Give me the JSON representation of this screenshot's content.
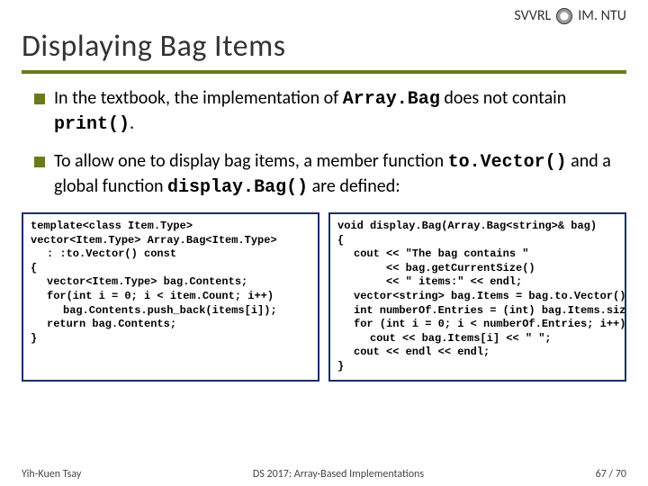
{
  "header": {
    "left": "",
    "lab": "SVVRL",
    "at": "@",
    "dept": "IM. NTU"
  },
  "title": "Displaying Bag Items",
  "bullets": [
    {
      "pre": "In the textbook, the implementation of ",
      "code1": "Array.Bag",
      "mid": " does not contain ",
      "code2": "print()",
      "post": "."
    },
    {
      "pre": "To allow one to display bag items, a member function ",
      "code1": "to.Vector()",
      "mid": " and a global function ",
      "code2": "display.Bag()",
      "post": " are defined:"
    }
  ],
  "code_left": [
    {
      "cls": "",
      "t": "template<class Item.Type>"
    },
    {
      "cls": "",
      "t": "vector<Item.Type> Array.Bag<Item.Type>"
    },
    {
      "cls": "ind1",
      "t": ": :to.Vector() const"
    },
    {
      "cls": "",
      "t": "{"
    },
    {
      "cls": "ind1",
      "t": "vector<Item.Type> bag.Contents;"
    },
    {
      "cls": "ind1",
      "t": "for(int i = 0; i < item.Count; i++)"
    },
    {
      "cls": "ind2",
      "t": "bag.Contents.push_back(items[i]);"
    },
    {
      "cls": "ind1",
      "t": "return bag.Contents;"
    },
    {
      "cls": "",
      "t": "}"
    }
  ],
  "code_right": [
    {
      "cls": "",
      "t": "void display.Bag(Array.Bag<string>& bag)"
    },
    {
      "cls": "",
      "t": "{"
    },
    {
      "cls": "ind1",
      "t": "cout << \"The bag contains \""
    },
    {
      "cls": "ind3",
      "t": "<< bag.getCurrentSize()"
    },
    {
      "cls": "ind3",
      "t": "<< \" items:\" << endl;"
    },
    {
      "cls": "ind1",
      "t": "vector<string> bag.Items = bag.to.Vector();"
    },
    {
      "cls": "ind1",
      "t": "int numberOf.Entries = (int) bag.Items.size();"
    },
    {
      "cls": "ind1",
      "t": "for (int i = 0; i < numberOf.Entries; i++)"
    },
    {
      "cls": "ind2",
      "t": "cout << bag.Items[i] << \" \";"
    },
    {
      "cls": "ind1",
      "t": "cout << endl << endl;"
    },
    {
      "cls": "",
      "t": "}"
    }
  ],
  "footer": {
    "left": "Yih-Kuen Tsay",
    "center": "DS 2017: Array-Based Implementations",
    "right": "67 / 70"
  }
}
